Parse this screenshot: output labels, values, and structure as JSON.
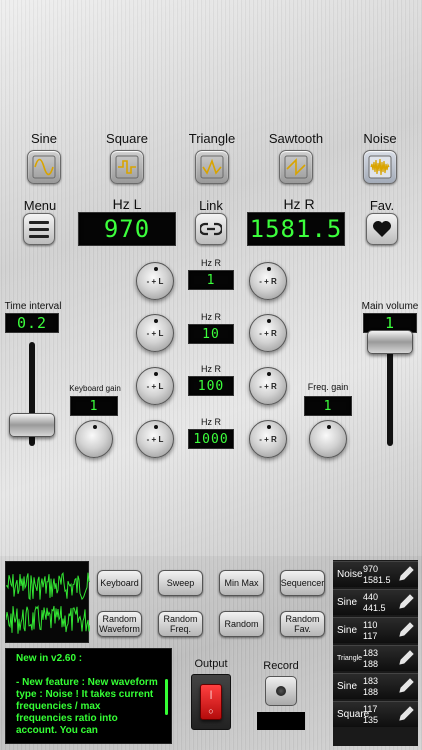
{
  "waveforms": [
    {
      "label": "Sine",
      "icon": "sine-wave-icon"
    },
    {
      "label": "Square",
      "icon": "square-wave-icon"
    },
    {
      "label": "Triangle",
      "icon": "triangle-wave-icon"
    },
    {
      "label": "Sawtooth",
      "icon": "sawtooth-wave-icon"
    },
    {
      "label": "Noise",
      "icon": "noise-wave-icon",
      "active": true
    }
  ],
  "top": {
    "menu_label": "Menu",
    "hz_l_label": "Hz L",
    "hz_l_value": "970",
    "link_label": "Link",
    "hz_r_label": "Hz R",
    "hz_r_value": "1581.5",
    "fav_label": "Fav."
  },
  "steps": [
    {
      "label": "Hz R",
      "value": "1"
    },
    {
      "label": "Hz R",
      "value": "10"
    },
    {
      "label": "Hz R",
      "value": "100"
    },
    {
      "label": "Hz R",
      "value": "1000"
    }
  ],
  "knob_text": {
    "left": "- + L",
    "right": "- + R"
  },
  "time_interval": {
    "label": "Time interval",
    "value": "0.2"
  },
  "main_volume": {
    "label": "Main volume",
    "value": "1"
  },
  "keyboard_gain": {
    "label": "Keyboard gain",
    "value": "1"
  },
  "freq_gain": {
    "label": "Freq. gain",
    "value": "1"
  },
  "buttons": {
    "keyboard": "Keyboard",
    "sweep": "Sweep",
    "minmax": "Min Max",
    "sequencer": "Sequencer",
    "random_waveform": "Random Waveform",
    "random_freq": "Random Freq.",
    "random": "Random",
    "random_fav": "Random Fav."
  },
  "news": {
    "title": "New in v2.60 :",
    "body": "- New feature : New waveform type : Noise ! It takes current frequencies / max frequencies ratio into account. You can"
  },
  "output_label": "Output",
  "record_label": "Record",
  "favorites": [
    {
      "name": "Noise",
      "v1": "970",
      "v2": "1581.5"
    },
    {
      "name": "Sine",
      "v1": "440",
      "v2": "441.5"
    },
    {
      "name": "Sine",
      "v1": "110",
      "v2": "117"
    },
    {
      "name": "Triangle",
      "v1": "183",
      "v2": "188"
    },
    {
      "name": "Sine",
      "v1": "183",
      "v2": "188"
    },
    {
      "name": "Square",
      "v1": "117",
      "v2": "135"
    }
  ],
  "slider_levels": {
    "time_interval": 0.2,
    "main_volume": 1.0
  },
  "colors": {
    "lcd_text": "#3cff3c",
    "news_text": "#35ff35",
    "oscilloscope_wave": "#33e633",
    "output_switch": "#d21a1a"
  }
}
